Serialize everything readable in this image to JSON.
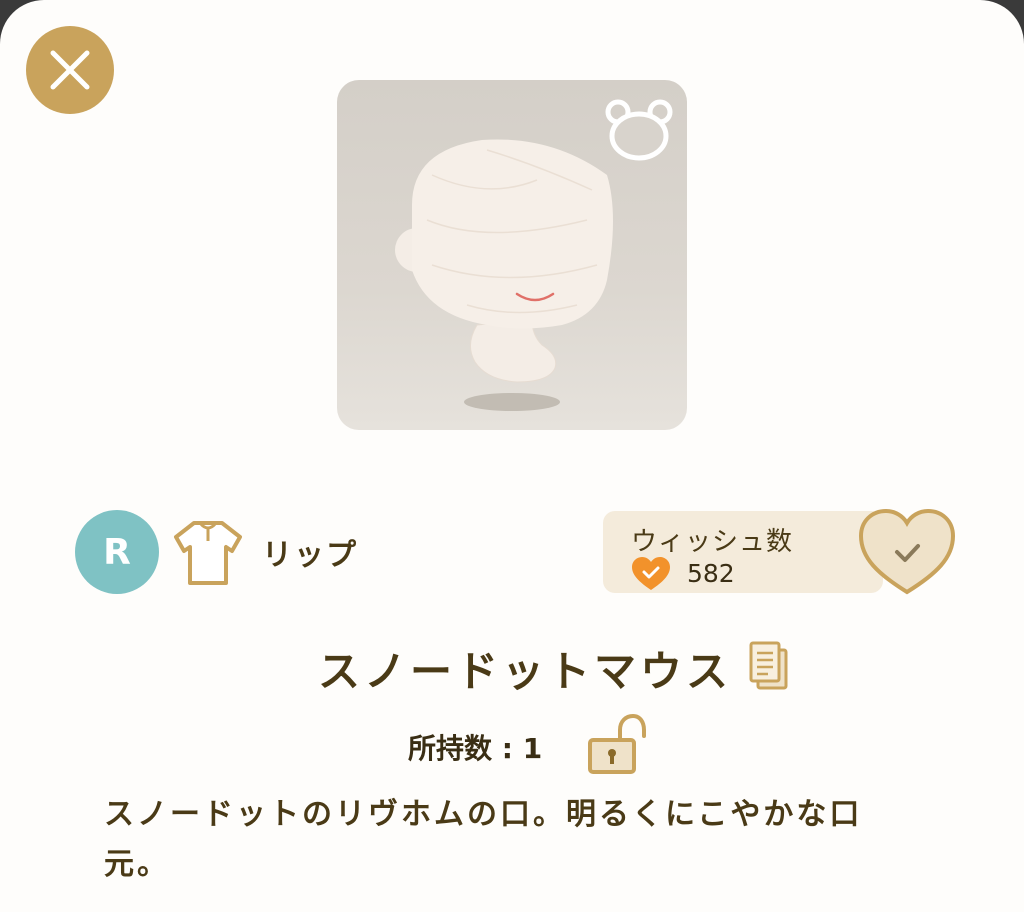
{
  "item": {
    "rarity": "R",
    "category_icon": "shirt-icon",
    "category": "リップ",
    "name": "スノードットマウス",
    "owned_label": "所持数 : 1",
    "description": "スノードットのリヴホムの口。明るくにこやかな口元。"
  },
  "wish": {
    "title": "ウィッシュ数",
    "count": "582"
  },
  "icons": {
    "close": "close-icon",
    "badge": "bear-icon",
    "copy": "document-icon",
    "lock": "padlock-open-icon",
    "wish_button": "heart-check-icon"
  },
  "colors": {
    "accent_gold": "#c9a35c",
    "rarity_teal": "#7fc2c4",
    "text_brown": "#4a3a16",
    "wish_orange": "#f2922b",
    "panel_beige": "#f4ebdb"
  }
}
